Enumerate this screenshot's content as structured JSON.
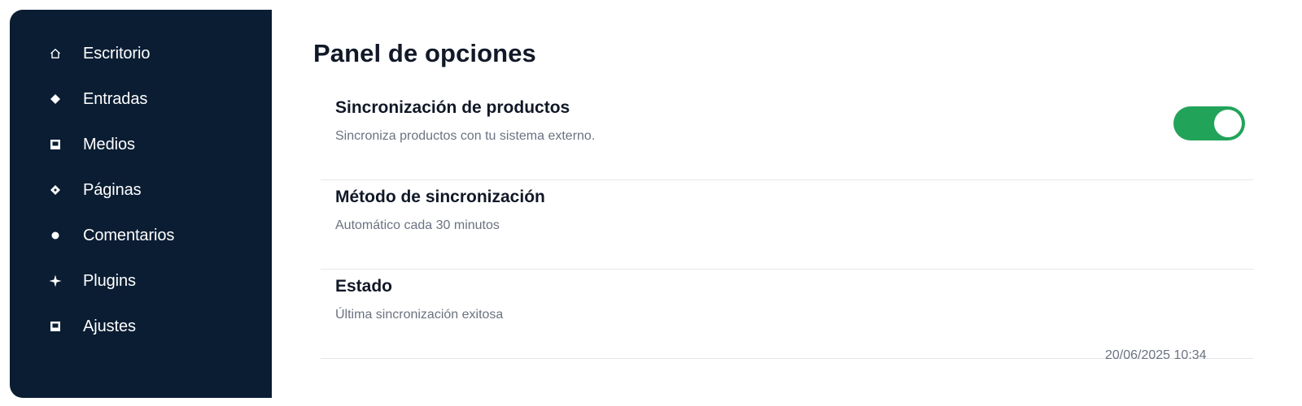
{
  "sidebar": {
    "items": [
      {
        "label": "Escritorio",
        "icon": "home-icon"
      },
      {
        "label": "Entradas",
        "icon": "diamond-icon"
      },
      {
        "label": "Medios",
        "icon": "media-icon"
      },
      {
        "label": "Páginas",
        "icon": "pages-icon"
      },
      {
        "label": "Comentarios",
        "icon": "comment-icon"
      },
      {
        "label": "Plugins",
        "icon": "plugin-icon"
      },
      {
        "label": "Ajustes",
        "icon": "settings-icon"
      }
    ]
  },
  "main": {
    "title": "Panel de opciones",
    "rows": [
      {
        "title": "Sincronización de productos",
        "description": "Sincroniza productos con tu sistema externo.",
        "toggle_on": true
      },
      {
        "title": "Método de sincronización",
        "description": "Automático cada 30 minutos"
      },
      {
        "title": "Estado",
        "description": "Última sincronización exitosa"
      }
    ],
    "timestamp": "20/06/2025 10:34"
  },
  "colors": {
    "sidebar_bg": "#0a1d33",
    "toggle_on": "#22a35a",
    "text_primary": "#111827",
    "text_secondary": "#6b7280"
  }
}
